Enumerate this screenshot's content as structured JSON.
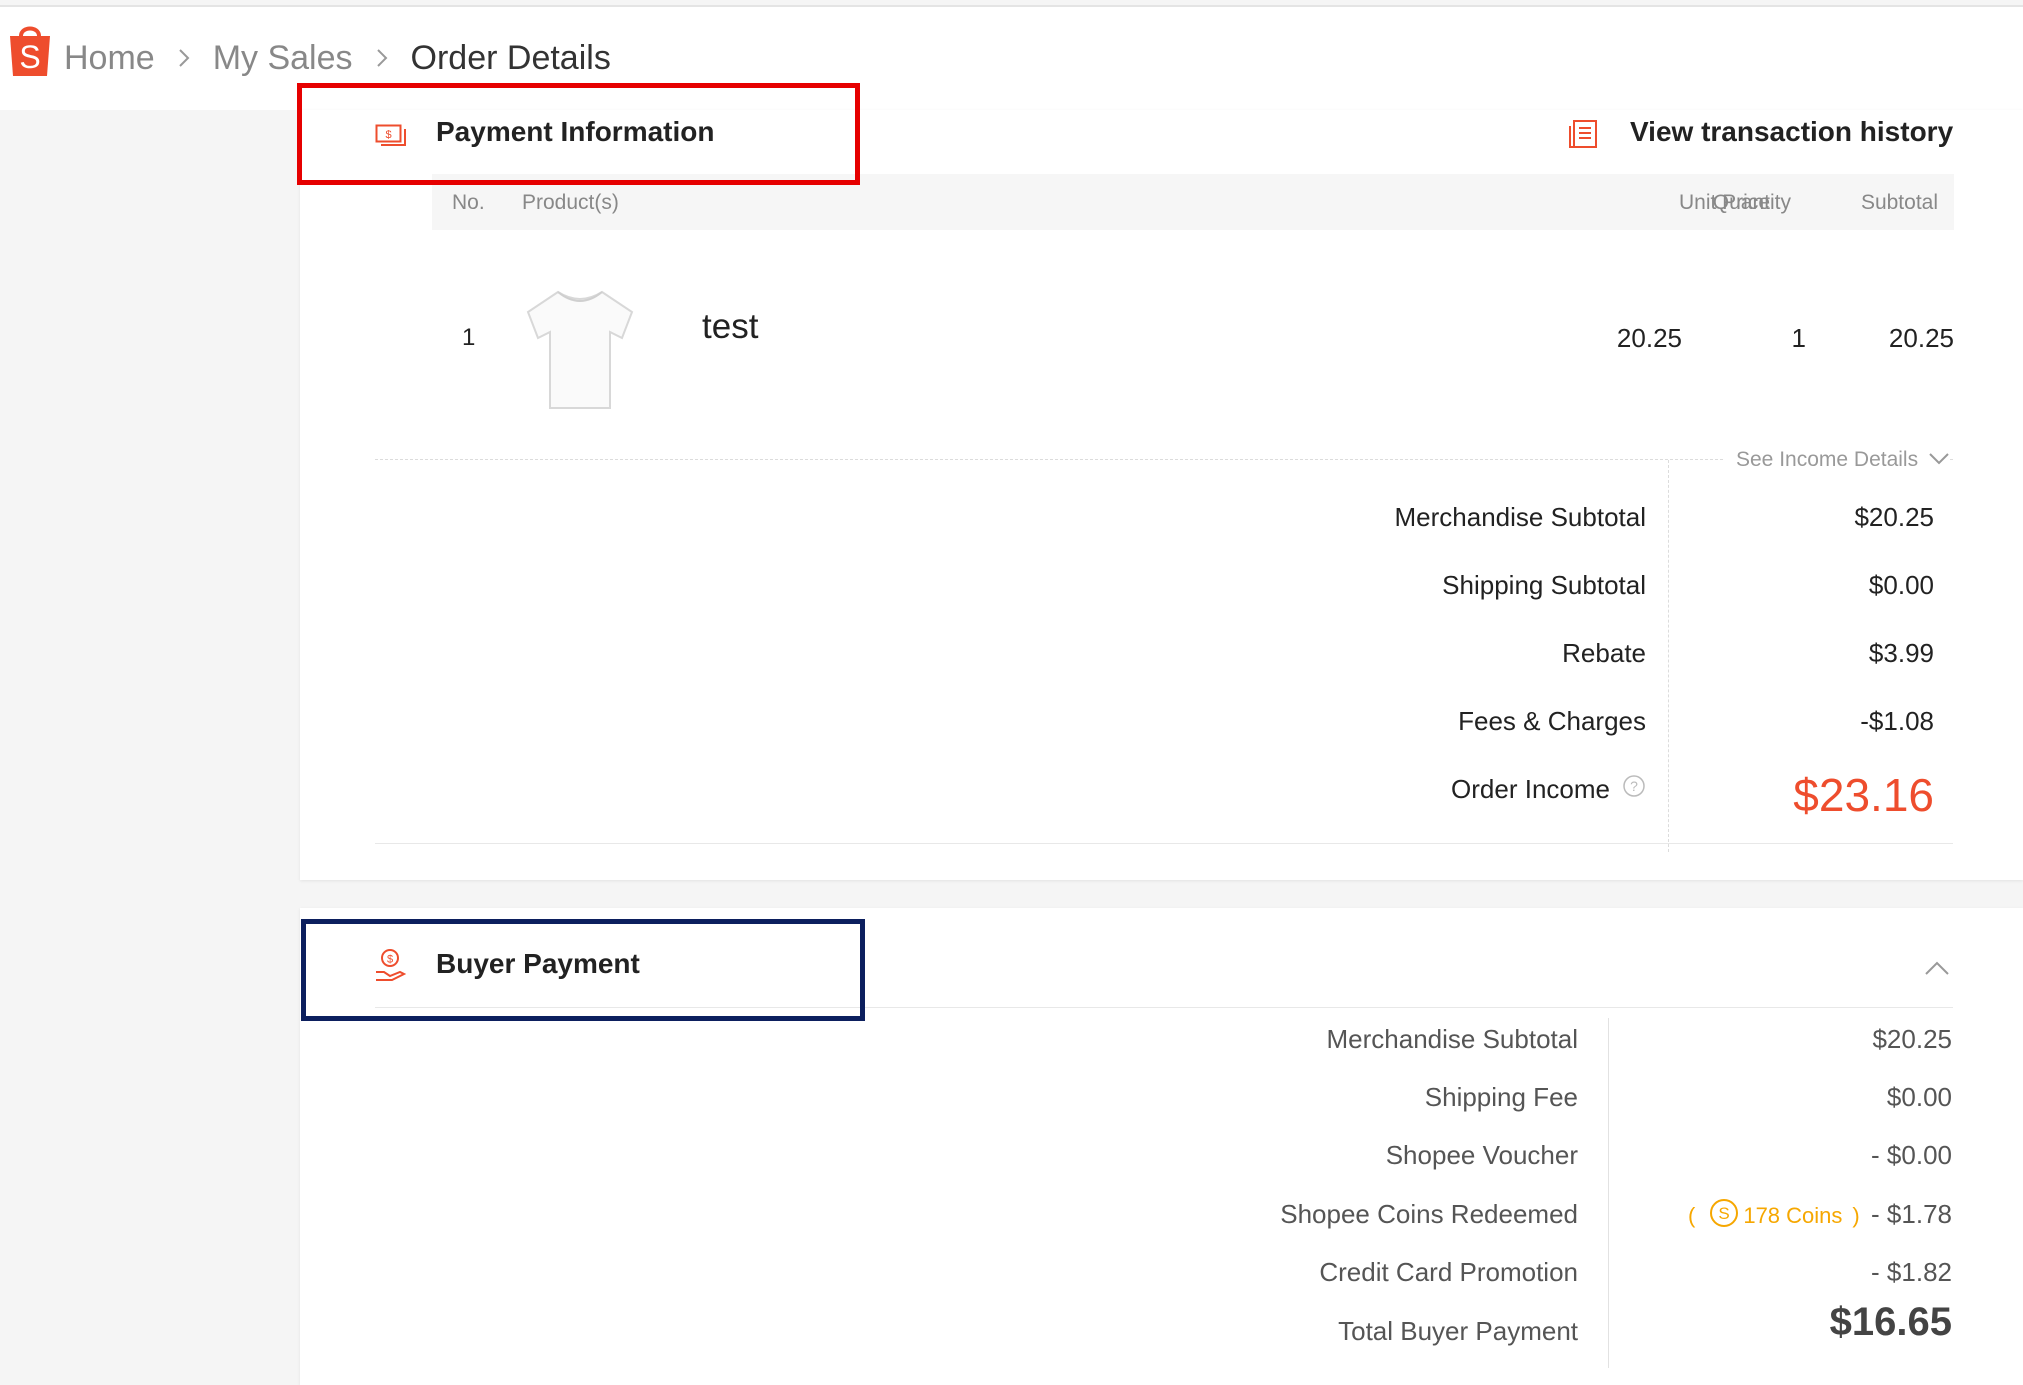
{
  "breadcrumb": {
    "home": "Home",
    "my_sales": "My Sales",
    "current": "Order Details"
  },
  "payment_info": {
    "title": "Payment Information",
    "view_history": "View transaction history",
    "columns": {
      "no": "No.",
      "product": "Product(s)",
      "unit_price": "Unit Price",
      "quantity": "Quantity",
      "subtotal": "Subtotal"
    },
    "row": {
      "no": "1",
      "name": "test",
      "unit_price": "20.25",
      "quantity": "1",
      "subtotal": "20.25"
    },
    "see_income": "See Income Details",
    "income": [
      {
        "label": "Merchandise Subtotal",
        "value": "$20.25"
      },
      {
        "label": "Shipping Subtotal",
        "value": "$0.00"
      },
      {
        "label": "Rebate",
        "value": "$3.99"
      },
      {
        "label": "Fees & Charges",
        "value": "-$1.08"
      }
    ],
    "order_income_label": "Order Income",
    "order_income_value": "$23.16"
  },
  "buyer_payment": {
    "title": "Buyer Payment",
    "rows": [
      {
        "label": "Merchandise Subtotal",
        "value": "$20.25"
      },
      {
        "label": "Shipping Fee",
        "value": "$0.00"
      },
      {
        "label": "Shopee Voucher",
        "value": "- $0.00"
      },
      {
        "label": "Shopee Coins Redeemed",
        "value": "- $1.78"
      },
      {
        "label": "Credit Card Promotion",
        "value": "- $1.82"
      }
    ],
    "coins_note": "178 Coins",
    "coins_open": "(",
    "coins_close": ")",
    "coin_symbol": "S",
    "total_label": "Total Buyer Payment",
    "total_value": "$16.65"
  },
  "colors": {
    "accent": "#ee4d2d",
    "income": "#ee4d2d",
    "coins": "#f6a700",
    "red_box": "#e60000",
    "navy_box": "#0c1f5e"
  },
  "logo_letter": "S"
}
